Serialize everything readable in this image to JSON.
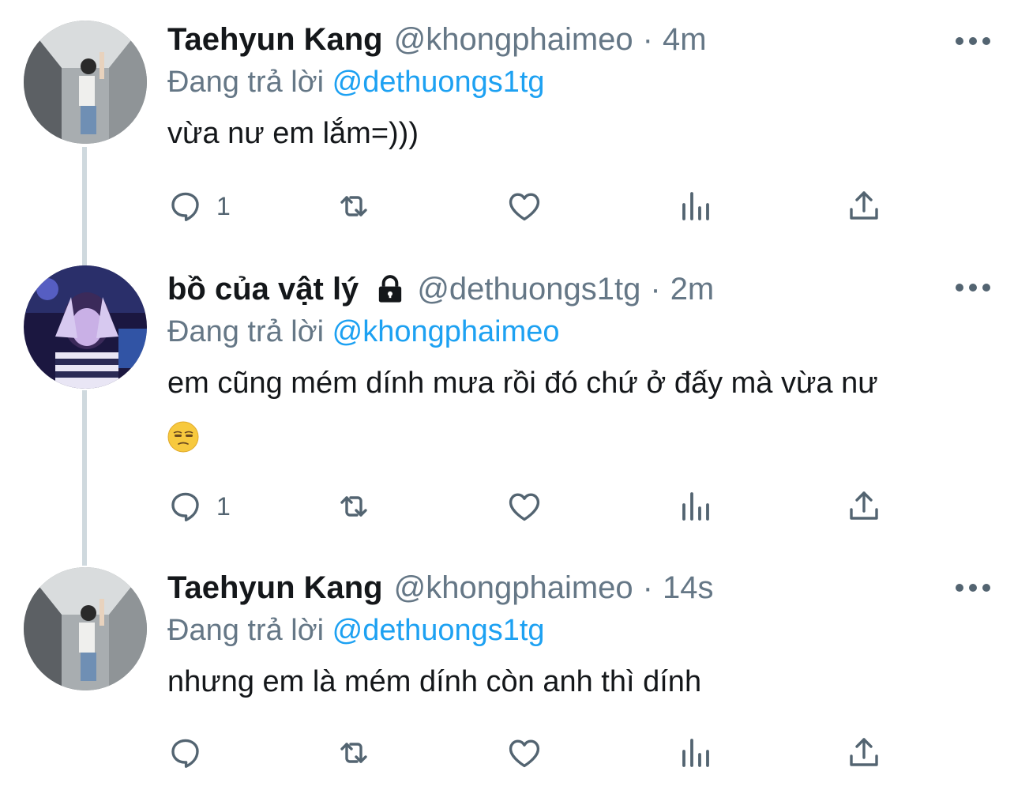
{
  "tweets": [
    {
      "name": "Taehyun Kang",
      "handle": "@khongphaimeo",
      "separator": "·",
      "time": "4m",
      "replying_prefix": "Đang trả lời",
      "replying_to": "@dethuongs1tg",
      "text": "vừa nư em lắm=)))",
      "reply_count": "1",
      "locked": false
    },
    {
      "name": "bồ của vật lý",
      "handle": "@dethuongs1tg",
      "separator": "·",
      "time": "2m",
      "replying_prefix": "Đang trả lời",
      "replying_to": "@khongphaimeo",
      "text": "em cũng mém dính mưa rồi đó chứ ở đấy mà vừa nư",
      "emoji": "unamused-face-emoji",
      "reply_count": "1",
      "locked": true
    },
    {
      "name": "Taehyun Kang",
      "handle": "@khongphaimeo",
      "separator": "·",
      "time": "14s",
      "replying_prefix": "Đang trả lời",
      "replying_to": "@dethuongs1tg",
      "text": "nhưng em là mém dính còn anh thì dính",
      "reply_count": "",
      "locked": false
    }
  ],
  "icons": {
    "reply": "reply-icon",
    "retweet": "retweet-icon",
    "like": "heart-icon",
    "views": "views-icon",
    "share": "share-icon",
    "more": "more-icon",
    "lock": "lock-icon"
  },
  "colors": {
    "link": "#1da1f2",
    "secondary_text": "#657786",
    "thread_line": "#cfd9de"
  }
}
